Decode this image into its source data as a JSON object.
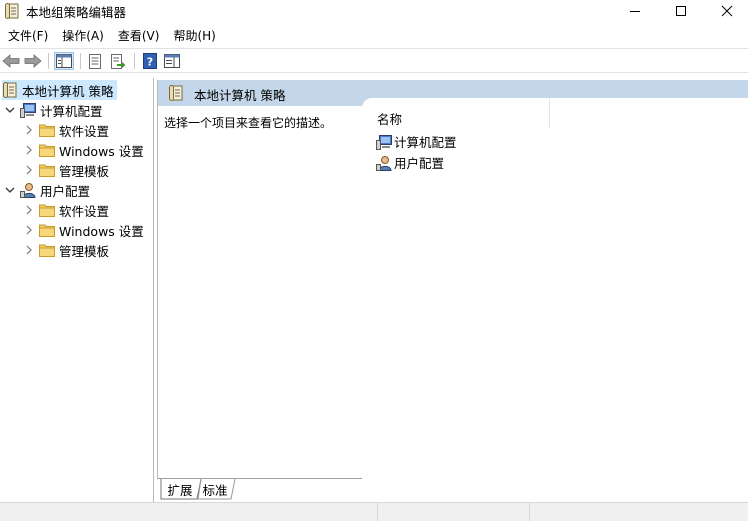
{
  "window": {
    "title": "本地组策略编辑器",
    "icon": "policy-document-icon"
  },
  "menu": {
    "items": [
      "文件(F)",
      "操作(A)",
      "查看(V)",
      "帮助(H)"
    ]
  },
  "toolbar": {
    "buttons": [
      "back-arrow-icon",
      "forward-arrow-icon",
      "show-hide-console-tree-icon",
      "properties-icon",
      "export-list-icon",
      "help-icon",
      "show-hide-action-pane-icon"
    ]
  },
  "tree": {
    "root": "本地计算机 策略",
    "computer_config": {
      "label": "计算机配置",
      "children": [
        "软件设置",
        "Windows 设置",
        "管理模板"
      ]
    },
    "user_config": {
      "label": "用户配置",
      "children": [
        "软件设置",
        "Windows 设置",
        "管理模板"
      ]
    }
  },
  "content": {
    "header_title": "本地计算机 策略",
    "description": "选择一个项目来查看它的描述。",
    "column_name": "名称",
    "items": [
      "计算机配置",
      "用户配置"
    ]
  },
  "tabs": {
    "extended": "扩展",
    "standard": "标准"
  },
  "colors": {
    "header_bg": "#c4d7ea",
    "selection_bg": "#cce8ff",
    "folder": "#e8c35a"
  }
}
